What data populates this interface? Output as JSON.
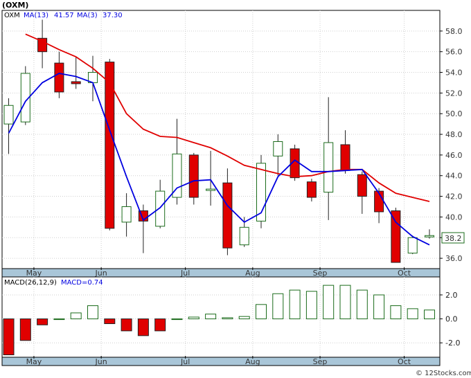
{
  "page": {
    "title": "(OXM)",
    "credit": "© 12Stocks.com"
  },
  "legend": {
    "symbol": "OXM",
    "ma13_label": "MA(13)",
    "ma13_value": "41.57",
    "ma3_label": "MA(3)",
    "ma3_value": "37.30"
  },
  "macd_legend": {
    "params": "MACD(26,12,9)",
    "value": "MACD=0.74"
  },
  "last_price_label": "38.2",
  "colors": {
    "up": "#1a6b1a",
    "down": "#e00000",
    "ma13": "#e00000",
    "ma3": "#0000e0",
    "macd": "#1a6b1a",
    "axis_band": "#a9c6d8",
    "label_box": "#1a6b1a"
  },
  "chart_data": [
    {
      "type": "candlestick",
      "title": "(OXM)",
      "ylim": [
        35,
        60
      ],
      "yticks": [
        "36.0",
        "38.0",
        "40.0",
        "42.0",
        "44.0",
        "46.0",
        "48.0",
        "50.0",
        "52.0",
        "54.0",
        "56.0",
        "58.0"
      ],
      "xticks": [
        {
          "label": "May",
          "pos": 1.5
        },
        {
          "label": "Jun",
          "pos": 5.5
        },
        {
          "label": "Jul",
          "pos": 10.5
        },
        {
          "label": "Aug",
          "pos": 14.5
        },
        {
          "label": "Sep",
          "pos": 18.5
        },
        {
          "label": "Oct",
          "pos": 23.5
        }
      ],
      "candles": [
        {
          "o": 49.0,
          "h": 51.5,
          "l": 46.1,
          "c": 50.8
        },
        {
          "o": 49.2,
          "h": 54.6,
          "l": 48.9,
          "c": 53.9
        },
        {
          "o": 57.3,
          "h": 59.1,
          "l": 54.4,
          "c": 56.0
        },
        {
          "o": 54.9,
          "h": 56.0,
          "l": 51.5,
          "c": 52.1
        },
        {
          "o": 53.1,
          "h": 55.5,
          "l": 52.4,
          "c": 52.9
        },
        {
          "o": 53.0,
          "h": 55.6,
          "l": 51.2,
          "c": 54.0
        },
        {
          "o": 55.0,
          "h": 55.3,
          "l": 38.7,
          "c": 38.9
        },
        {
          "o": 39.5,
          "h": 42.3,
          "l": 38.1,
          "c": 41.0
        },
        {
          "o": 40.6,
          "h": 41.2,
          "l": 36.5,
          "c": 39.6
        },
        {
          "o": 39.1,
          "h": 43.6,
          "l": 38.9,
          "c": 42.5
        },
        {
          "o": 41.9,
          "h": 49.5,
          "l": 41.2,
          "c": 46.1
        },
        {
          "o": 46.0,
          "h": 46.2,
          "l": 41.2,
          "c": 41.9
        },
        {
          "o": 42.7,
          "h": 46.4,
          "l": 41.1,
          "c": 42.7
        },
        {
          "o": 43.3,
          "h": 44.7,
          "l": 36.3,
          "c": 37.0
        },
        {
          "o": 37.3,
          "h": 40.0,
          "l": 37.1,
          "c": 39.0
        },
        {
          "o": 39.6,
          "h": 46.0,
          "l": 38.9,
          "c": 45.2
        },
        {
          "o": 45.9,
          "h": 48.0,
          "l": 44.0,
          "c": 47.3
        },
        {
          "o": 46.6,
          "h": 47.0,
          "l": 43.5,
          "c": 43.8
        },
        {
          "o": 43.4,
          "h": 43.7,
          "l": 41.5,
          "c": 41.9
        },
        {
          "o": 42.4,
          "h": 51.6,
          "l": 39.7,
          "c": 47.2
        },
        {
          "o": 47.0,
          "h": 48.4,
          "l": 44.2,
          "c": 44.5
        },
        {
          "o": 44.1,
          "h": 44.4,
          "l": 40.3,
          "c": 42.0
        },
        {
          "o": 42.5,
          "h": 42.8,
          "l": 39.4,
          "c": 40.5
        },
        {
          "o": 40.6,
          "h": 40.9,
          "l": 35.6,
          "c": 35.6
        },
        {
          "o": 36.5,
          "h": 38.2,
          "l": 36.4,
          "c": 38.0
        },
        {
          "o": 38.2,
          "h": 38.8,
          "l": 37.9,
          "c": 38.2
        }
      ],
      "ma13": [
        null,
        57.7,
        57.0,
        56.2,
        55.5,
        54.4,
        53.0,
        50.0,
        48.5,
        47.8,
        47.7,
        47.2,
        46.7,
        45.9,
        45.0,
        44.6,
        44.2,
        43.9,
        44.0,
        44.4,
        44.6,
        44.6,
        43.3,
        42.3,
        41.9,
        41.5
      ],
      "ma3": [
        48.1,
        51.2,
        53.0,
        53.9,
        53.6,
        53.0,
        48.4,
        43.9,
        39.7,
        40.9,
        42.8,
        43.5,
        43.6,
        41.1,
        39.5,
        40.4,
        43.9,
        45.5,
        44.4,
        44.4,
        44.5,
        44.6,
        42.3,
        39.5,
        38.1,
        37.3
      ]
    },
    {
      "type": "bar",
      "title": "MACD(26,12,9)",
      "ylim": [
        -3.2,
        3.5
      ],
      "yticks": [
        "2.0",
        "0.0",
        "-2.0"
      ],
      "values": [
        -3.0,
        -1.8,
        -0.5,
        0.0,
        0.5,
        1.1,
        -0.4,
        -1.0,
        -1.4,
        -1.0,
        0.0,
        0.15,
        0.4,
        0.1,
        0.2,
        1.2,
        2.1,
        2.4,
        2.3,
        2.8,
        2.8,
        2.4,
        2.0,
        1.1,
        0.85,
        0.74
      ]
    }
  ]
}
